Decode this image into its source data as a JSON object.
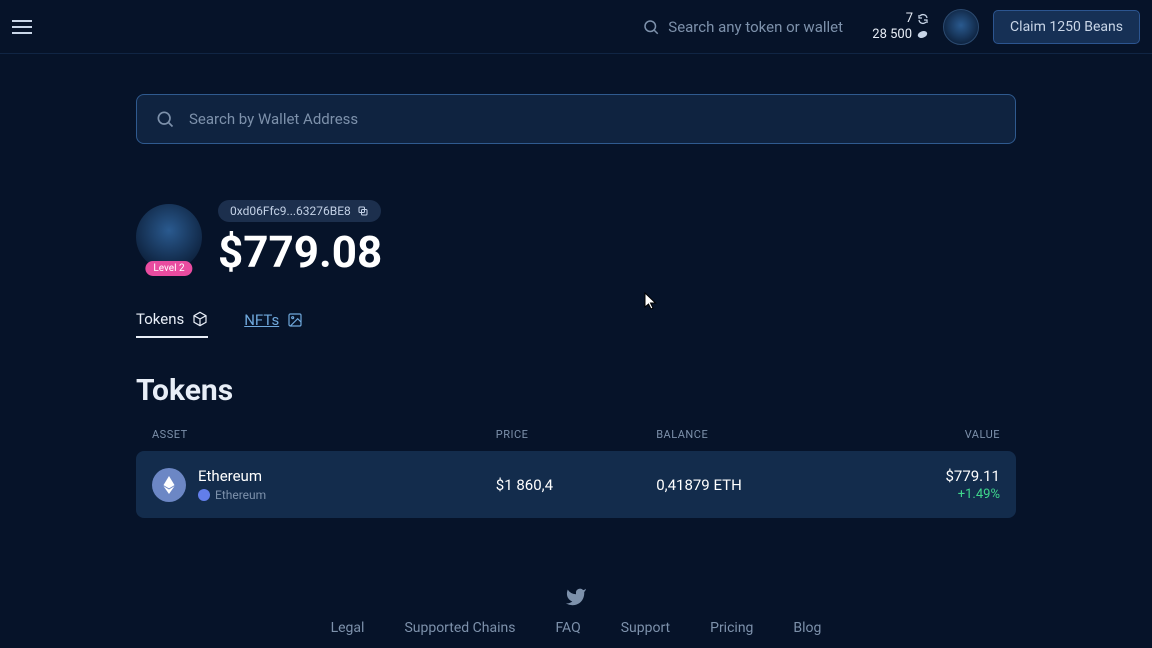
{
  "top": {
    "search_placeholder": "Search any token or wallet",
    "stat_top": "7",
    "stat_bottom": "28 500",
    "claim_label": "Claim 1250 Beans"
  },
  "search": {
    "placeholder": "Search by Wallet Address"
  },
  "profile": {
    "address": "0xd06Ffc9...63276BE8",
    "level": "Level 2",
    "balance": "$779.08"
  },
  "tabs": {
    "tokens": "Tokens",
    "nfts": "NFTs"
  },
  "section": {
    "title": "Tokens",
    "headers": {
      "asset": "ASSET",
      "price": "PRICE",
      "balance": "BALANCE",
      "value": "VALUE"
    }
  },
  "tokens": [
    {
      "name": "Ethereum",
      "chain": "Ethereum",
      "price": "$1 860,4",
      "balance": "0,41879 ETH",
      "value": "$779.11",
      "change": "+1.49%"
    }
  ],
  "footer": {
    "links": [
      "Legal",
      "Supported Chains",
      "FAQ",
      "Support",
      "Pricing",
      "Blog"
    ]
  }
}
